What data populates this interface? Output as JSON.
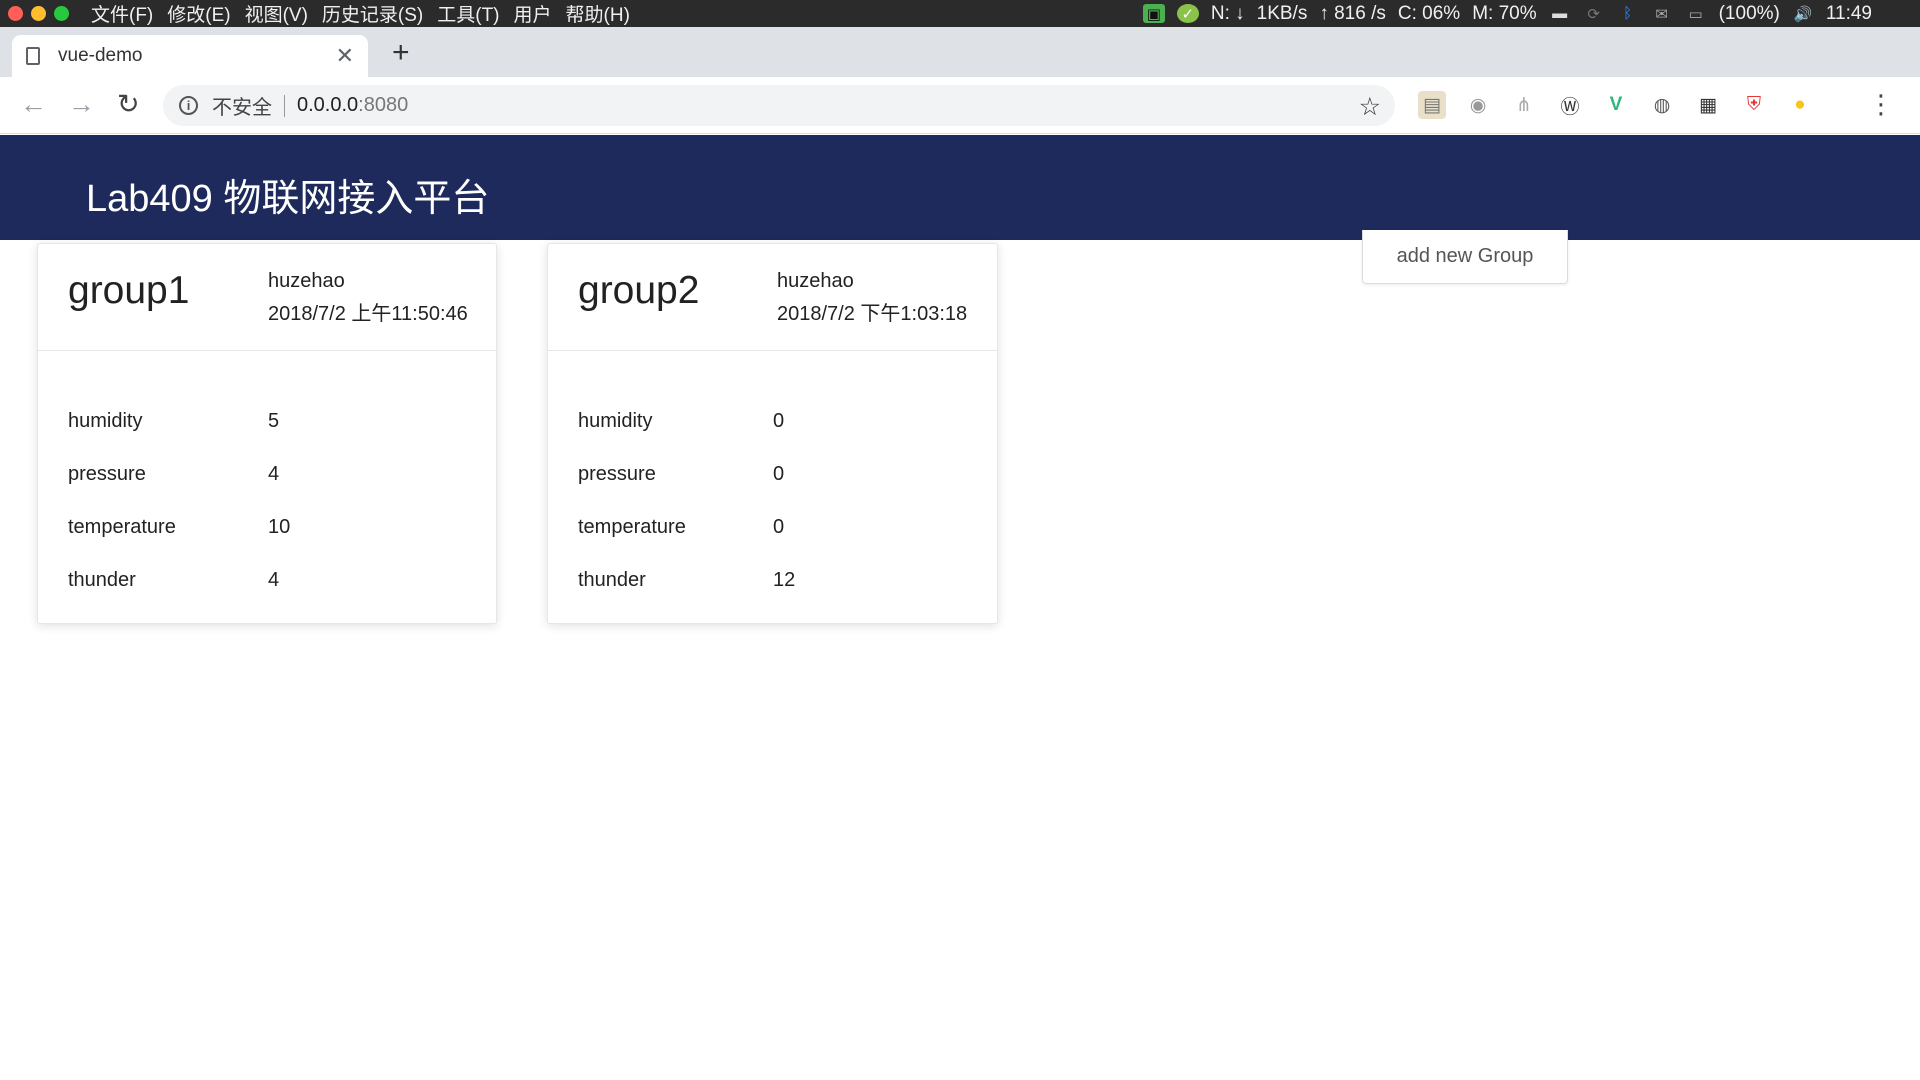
{
  "menubar": {
    "items": [
      "文件(F)",
      "修改(E)",
      "视图(V)",
      "历史记录(S)",
      "工具(T)",
      "用户",
      "帮助(H)"
    ],
    "tray": {
      "net_label": "N: ↓",
      "down": "1KB/s",
      "up": "↑ 816 /s",
      "cpu": "C: 06%",
      "mem": "M: 70%",
      "battery": "(100%)",
      "time": "11:49"
    }
  },
  "browser": {
    "tab_title": "vue-demo",
    "insecure_label": "不安全",
    "url_host": "0.0.0.0",
    "url_port": ":8080"
  },
  "app": {
    "title": "Lab409 物联网接入平台",
    "add_group_label": "add new Group"
  },
  "groups": [
    {
      "name": "group1",
      "user": "huzehao",
      "time": "2018/7/2 上午11:50:46",
      "metrics": [
        {
          "label": "humidity",
          "value": "5"
        },
        {
          "label": "pressure",
          "value": "4"
        },
        {
          "label": "temperature",
          "value": "10"
        },
        {
          "label": "thunder",
          "value": "4"
        }
      ]
    },
    {
      "name": "group2",
      "user": "huzehao",
      "time": "2018/7/2 下午1:03:18",
      "metrics": [
        {
          "label": "humidity",
          "value": "0"
        },
        {
          "label": "pressure",
          "value": "0"
        },
        {
          "label": "temperature",
          "value": "0"
        },
        {
          "label": "thunder",
          "value": "12"
        }
      ]
    }
  ],
  "colors": {
    "header_bg": "#1d2a5b",
    "menubar_bg": "#2b2b2b"
  }
}
